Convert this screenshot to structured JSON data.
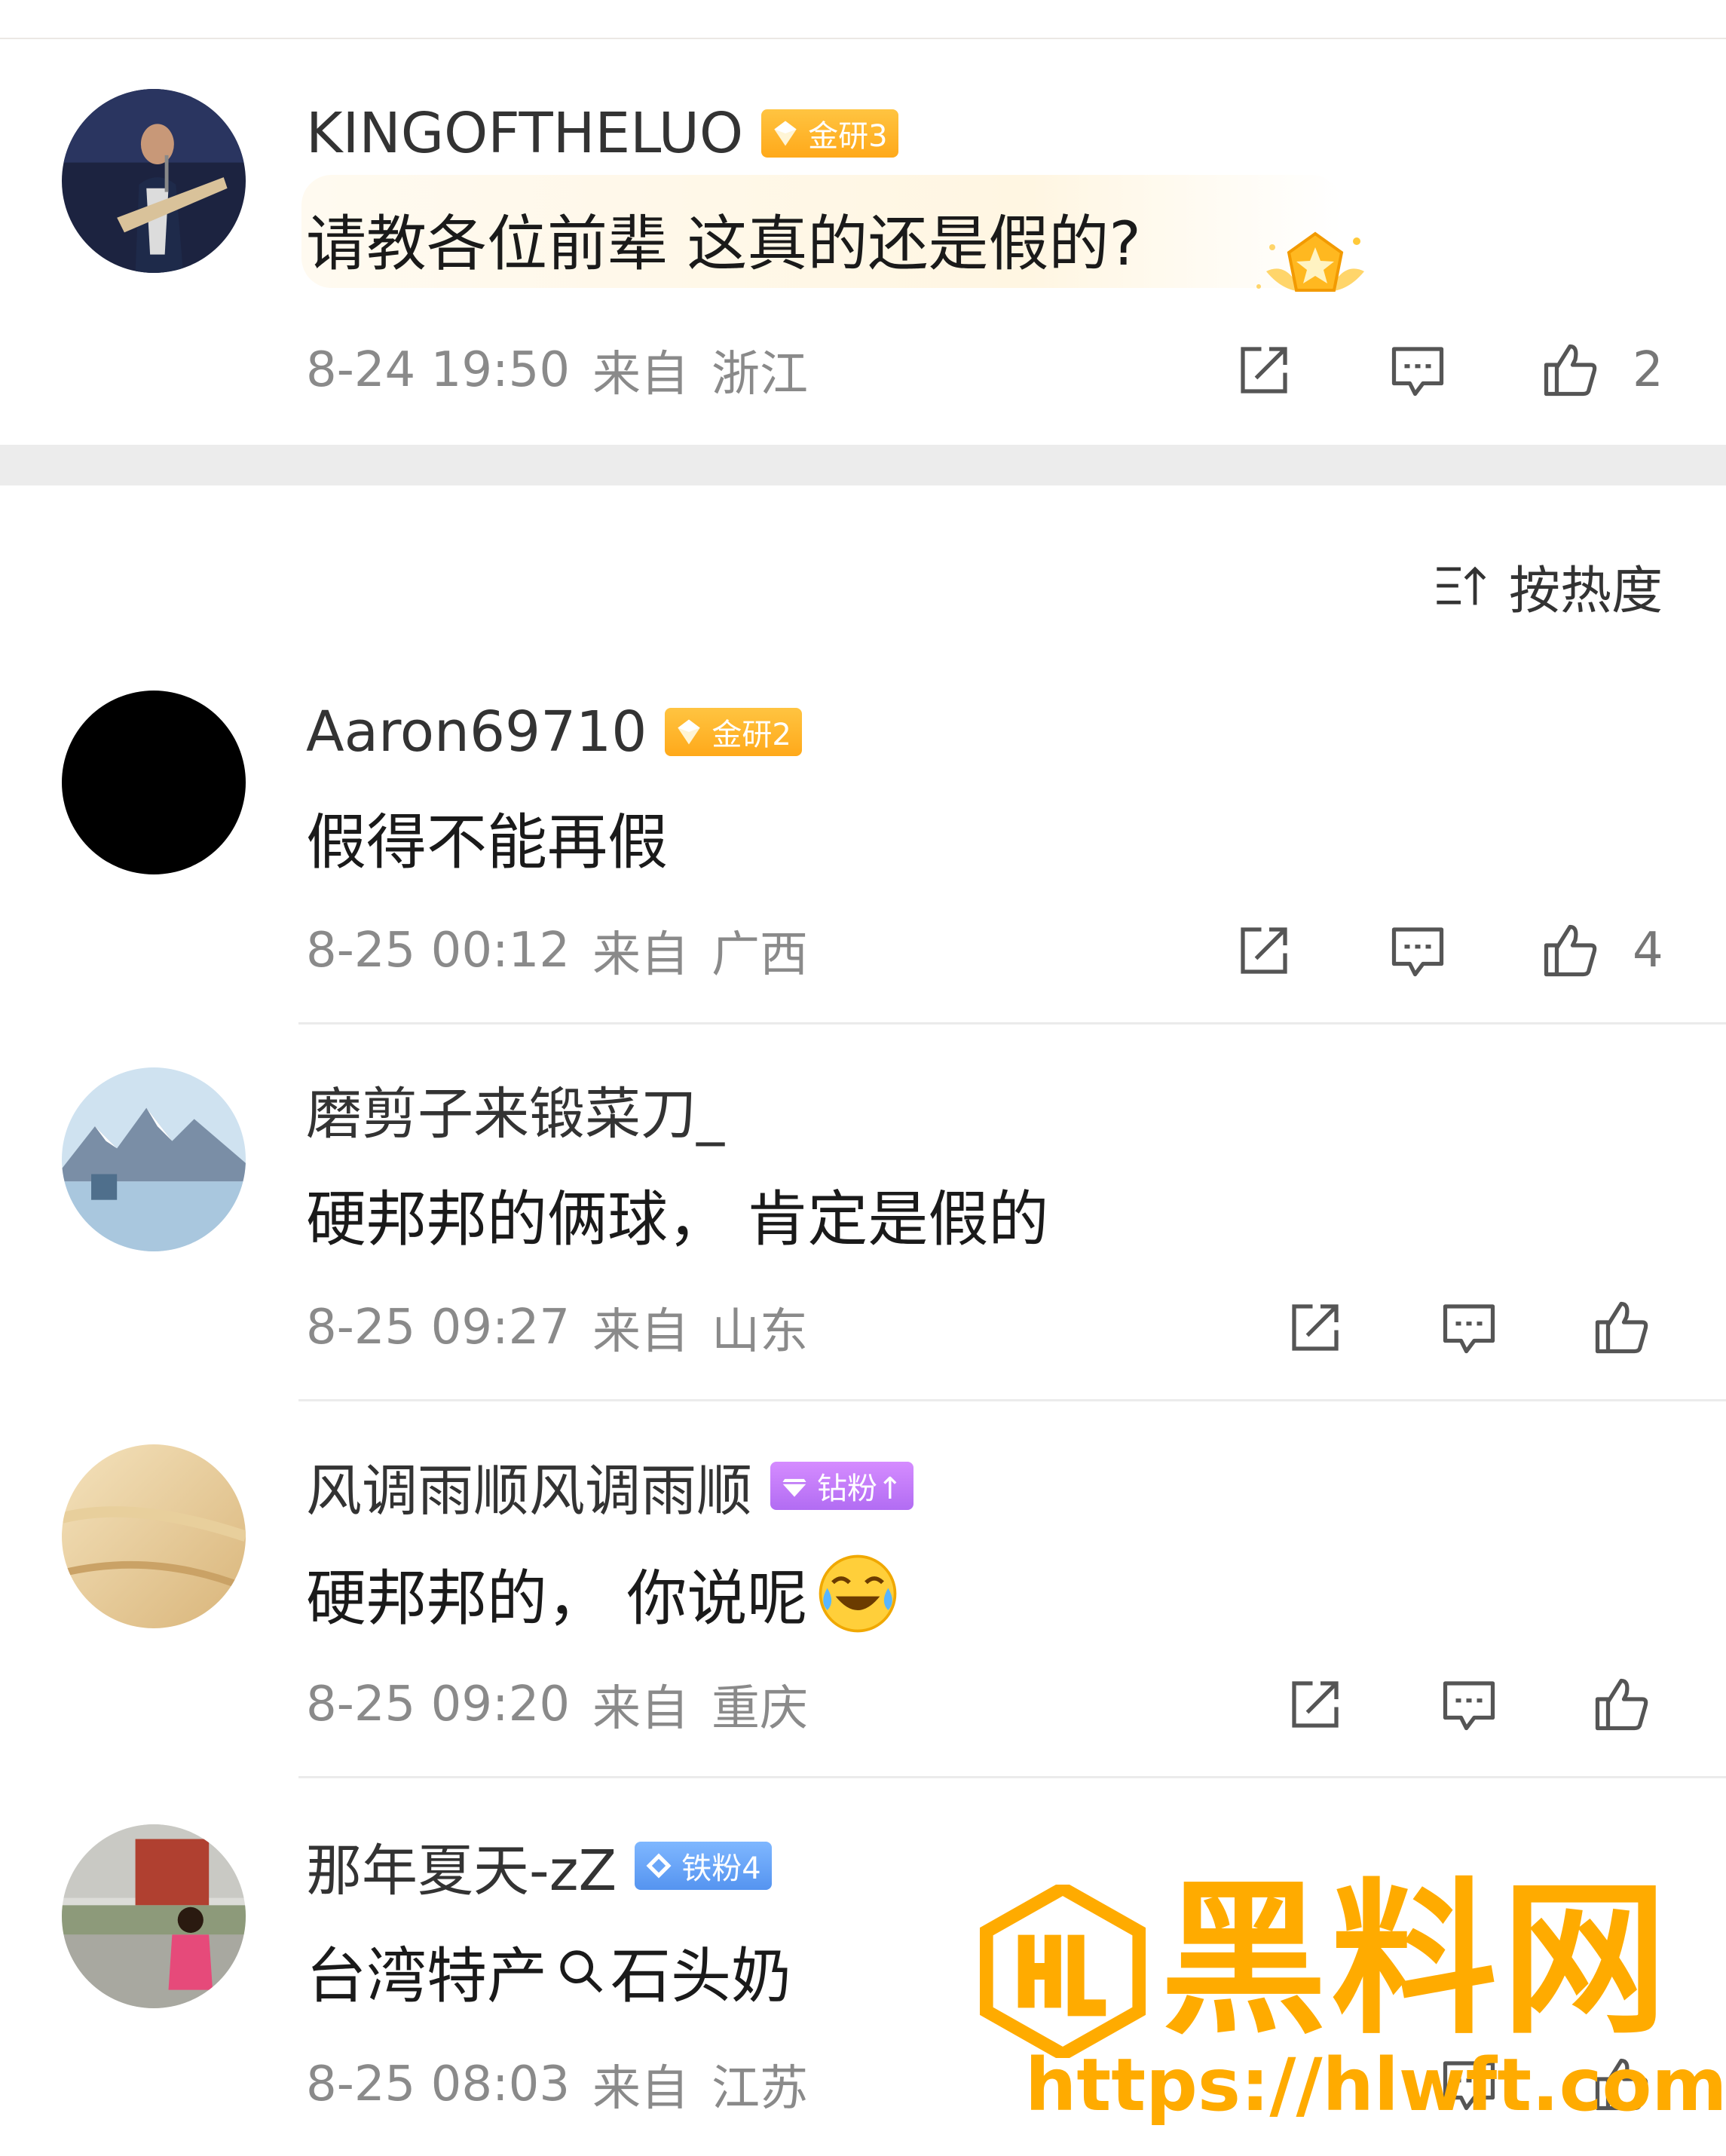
{
  "post": {
    "username": "KINGOFTHELUO",
    "badge": "金研3",
    "text": "请教各位前辈 这真的还是假的?",
    "time": "8-24 19:50",
    "from_label": "来自",
    "location": "浙江",
    "likes": "2"
  },
  "sort": {
    "label": "按热度"
  },
  "comments": [
    {
      "username": "Aaron69710",
      "badge": "金研2",
      "text": "假得不能再假",
      "time": "8-25 00:12",
      "from_label": "来自",
      "location": "广西",
      "likes": "4"
    },
    {
      "username": "磨剪子来锻菜刀_",
      "text": "硬邦邦的俩球，  肯定是假的",
      "time": "8-25 09:27",
      "from_label": "来自",
      "location": "山东"
    },
    {
      "username": "风调雨顺风调雨顺",
      "badge": "钻粉↑",
      "text": "硬邦邦的，  你说呢",
      "time": "8-25 09:20",
      "from_label": "来自",
      "location": "重庆"
    },
    {
      "username": "那年夏天-zZ",
      "badge": "铁粉4",
      "text_before": "台湾特产",
      "text_after": "石头奶",
      "time": "8-25 08:03",
      "from_label": "来自",
      "location": "江苏"
    }
  ],
  "watermark": {
    "title": "黑料网",
    "url": "https://hlwft.com"
  },
  "icons": [
    "repost-icon",
    "comment-icon",
    "like-icon",
    "sort-icon",
    "search-icon",
    "laugh-cry-emoji-icon",
    "medal-icon"
  ],
  "colors": {
    "gold_badge": "#ffb12a",
    "purple_badge": "#c07cf7",
    "blue_badge": "#6aa6f8",
    "watermark": "#ffab00",
    "meta_text": "#8a8a8a"
  }
}
